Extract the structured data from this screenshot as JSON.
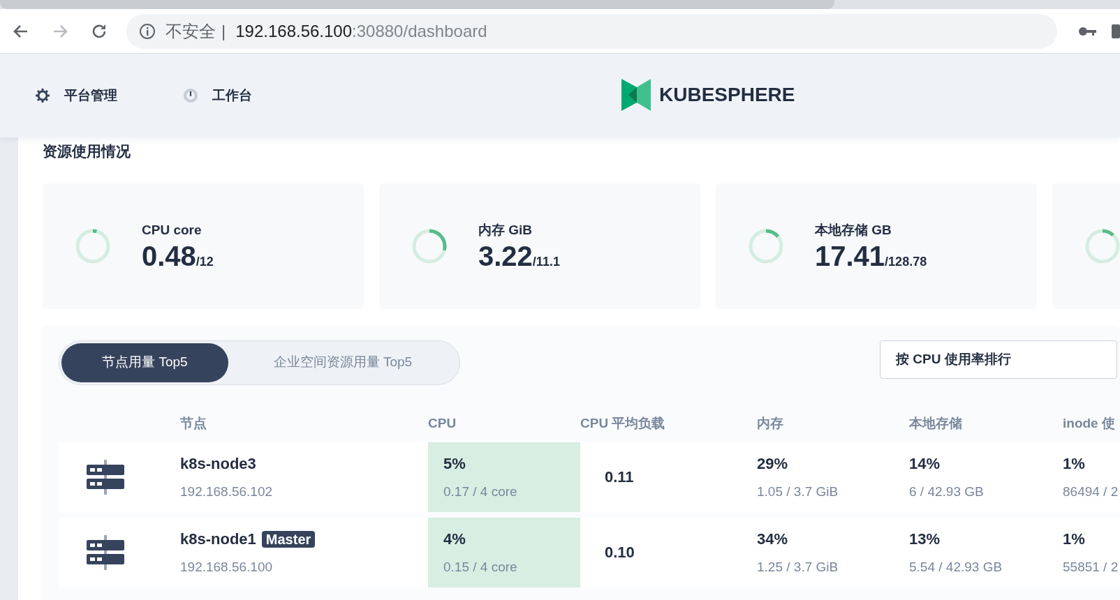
{
  "browser": {
    "security": "不安全",
    "separator": "|",
    "host": "192.168.56.100",
    "path": ":30880/dashboard"
  },
  "header": {
    "nav": [
      {
        "label": "平台管理"
      },
      {
        "label": "工作台"
      }
    ],
    "logo": "KUBESPHERE"
  },
  "section_title": "资源使用情况",
  "stats": [
    {
      "label": "CPU core",
      "value": "0.48",
      "total": "/12",
      "level": 0.04
    },
    {
      "label": "内存 GiB",
      "value": "3.22",
      "total": "/11.1",
      "level": 0.29
    },
    {
      "label": "本地存储 GB",
      "value": "17.41",
      "total": "/128.78",
      "level": 0.14
    },
    {
      "level": 0.12
    }
  ],
  "tabs": [
    {
      "label": "节点用量 Top5",
      "selected": true
    },
    {
      "label": "企业空间资源用量 Top5",
      "selected": false
    }
  ],
  "sort_select": {
    "value": "按 CPU 使用率排行"
  },
  "table": {
    "columns": [
      "节点",
      "CPU",
      "CPU 平均负载",
      "内存",
      "本地存储",
      "inode 使"
    ],
    "rows": [
      {
        "name": "k8s-node3",
        "ip": "192.168.56.102",
        "badge": null,
        "cpu": "5%",
        "cpu_detail": "0.17 / 4 core",
        "load": "0.11",
        "memory": "29%",
        "memory_detail": "1.05 / 3.7 GiB",
        "storage": "14%",
        "storage_detail": "6 / 42.93 GB",
        "inode": "1%",
        "inode_detail": "86494 / 2"
      },
      {
        "name": "k8s-node1",
        "ip": "192.168.56.100",
        "badge": "Master",
        "cpu": "4%",
        "cpu_detail": "0.15 / 4 core",
        "load": "0.10",
        "memory": "34%",
        "memory_detail": "1.25 / 3.7 GiB",
        "storage": "13%",
        "storage_detail": "5.54 / 42.93 GB",
        "inode": "1%",
        "inode_detail": "55851 / 2"
      }
    ]
  }
}
